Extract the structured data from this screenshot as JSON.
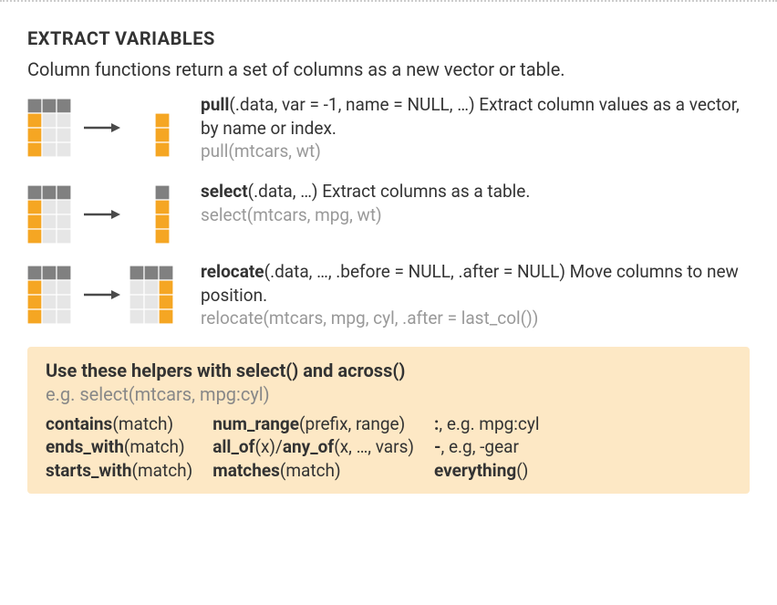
{
  "heading": "EXTRACT VARIABLES",
  "intro": "Column functions return a set of columns as a new vector or table.",
  "funcs": {
    "pull": {
      "name": "pull",
      "sig_suffix": "(.data,  var = -1, name = NULL, …) ",
      "desc": "Extract column values as a vector, by name or index.",
      "example": "pull(mtcars, wt)"
    },
    "select": {
      "name": "select",
      "sig_suffix": "(.data, …) ",
      "desc": "Extract columns as a table.",
      "example": "select(mtcars, mpg, wt)"
    },
    "relocate": {
      "name": "relocate",
      "sig_suffix": "(.data, …, .before = NULL, .after = NULL) ",
      "desc": "Move columns to new position.",
      "example": "relocate(mtcars, mpg, cyl, .after = last_col())"
    }
  },
  "helpers": {
    "title": "Use these helpers with select() and across()",
    "example": "e.g. select(mtcars, mpg:cyl)",
    "col1": {
      "contains": {
        "fn": "contains",
        "args": "(match)"
      },
      "ends_with": {
        "fn": "ends_with",
        "args": "(match)"
      },
      "starts_with": {
        "fn": "starts_with",
        "args": "(match)"
      }
    },
    "col2": {
      "num_range": {
        "fn": "num_range",
        "args": "(prefix, range)"
      },
      "all_any": {
        "fn": "all_of",
        "mid": "(x)/",
        "fn2": "any_of",
        "args2": "(x, …, vars)"
      },
      "matches": {
        "fn": "matches",
        "args": "(match)"
      }
    },
    "col3": {
      "range": {
        "prefix": ":",
        "text": ", e.g. mpg:cyl"
      },
      "neg": {
        "prefix": "-",
        "text": ", e.g, -gear"
      },
      "everything": {
        "fn": "everything",
        "args": "()"
      }
    }
  }
}
